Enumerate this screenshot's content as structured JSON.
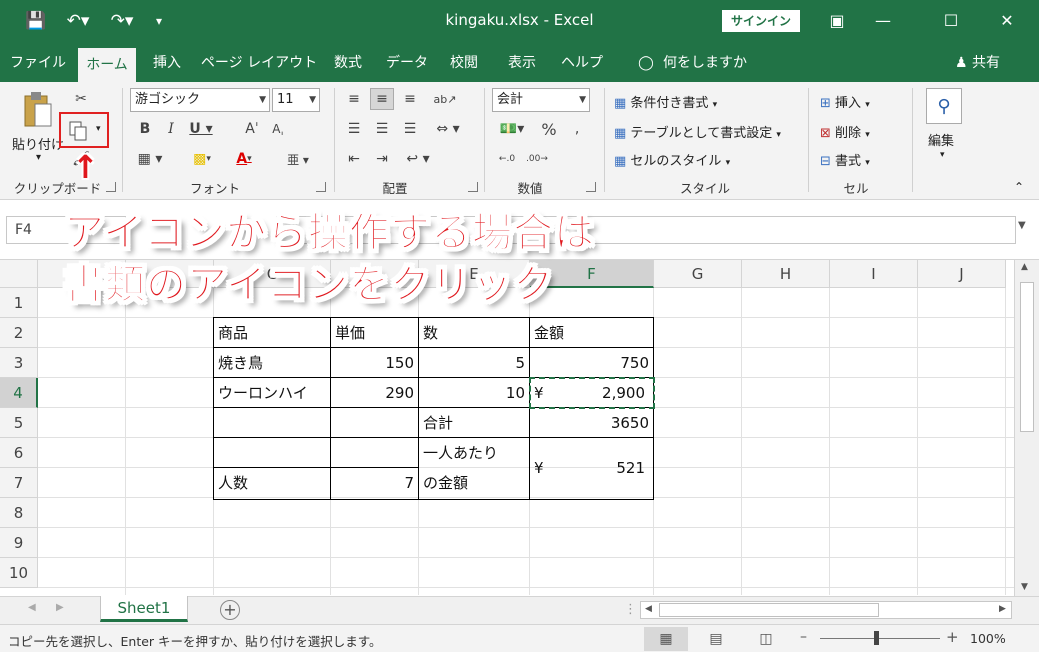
{
  "window": {
    "title": "kingaku.xlsx  -  Excel",
    "signin_label": "サインイン"
  },
  "tabs": [
    "ファイル",
    "ホーム",
    "挿入",
    "ページ レイアウト",
    "数式",
    "データ",
    "校閲",
    "表示",
    "ヘルプ",
    "何をしますか"
  ],
  "share_label": "共有",
  "ribbon": {
    "clipboard": {
      "label": "クリップボード",
      "paste_label": "貼り付け"
    },
    "font": {
      "label": "フォント",
      "font_name": "游ゴシック",
      "font_size": "11"
    },
    "alignment": {
      "label": "配置"
    },
    "number": {
      "label": "数値",
      "format": "会計",
      "percent": "%"
    },
    "styles": {
      "label": "スタイル",
      "conditional": "条件付き書式",
      "table": "テーブルとして書式設定",
      "cell_style": "セルのスタイル"
    },
    "cells": {
      "label": "セル",
      "insert": "挿入",
      "delete": "削除",
      "format": "書式"
    },
    "editing": {
      "label": "編集"
    }
  },
  "formula_bar": {
    "name_box": "F4",
    "content": ""
  },
  "columns": [
    "A",
    "B",
    "C",
    "D",
    "E",
    "F",
    "G",
    "H",
    "I",
    "J"
  ],
  "rows": [
    "1",
    "2",
    "3",
    "4",
    "5",
    "6",
    "7",
    "8",
    "9",
    "10"
  ],
  "cells": {
    "c2": "商品",
    "d2": "単価",
    "e2": "数",
    "f2": "金額",
    "c3": "焼き鳥",
    "d3": "150",
    "e3": "5",
    "f3": "750",
    "c4": "ウーロンハイ",
    "d4": "290",
    "e4": "10",
    "f4_currency": "¥",
    "f4_value": "2,900",
    "e5": "合計",
    "f5": "3650",
    "e6": "一人あたり",
    "e7": "の金額",
    "f67_currency": "¥",
    "f67_value": "521",
    "c7": "人数",
    "d7": "7"
  },
  "sheet_tab": "Sheet1",
  "status": {
    "message": "コピー先を選択し、Enter キーを押すか、貼り付けを選択します。",
    "zoom": "100%"
  },
  "annotation": {
    "line1": "アイコンから操作する場合は",
    "line2": "書類のアイコンをクリック",
    "arrow": "↑"
  },
  "colors": {
    "excel_green": "#217346",
    "annotation_red": "#e0181e"
  }
}
